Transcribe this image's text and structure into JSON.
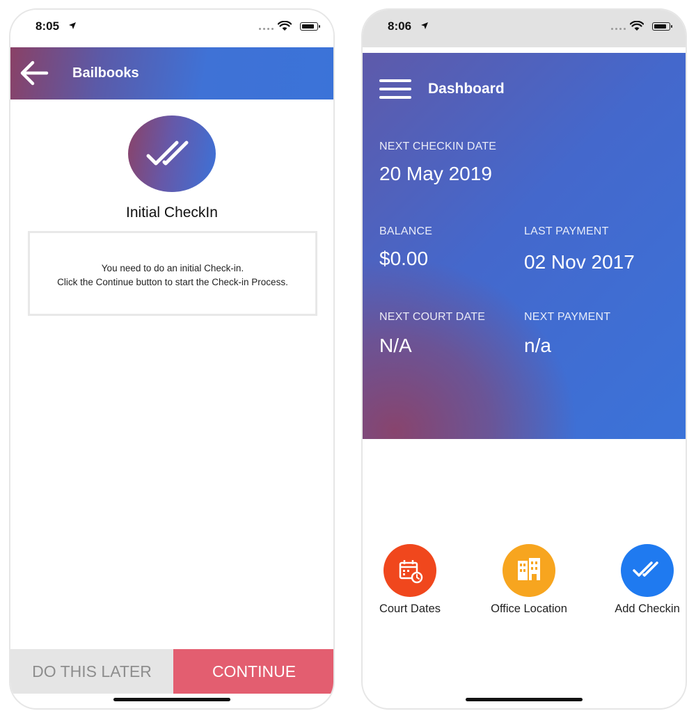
{
  "left": {
    "status": {
      "time": "8:05"
    },
    "appbar": {
      "title": "Bailbooks"
    },
    "heading": "Initial CheckIn",
    "message": {
      "line1": "You need to do an initial Check-in.",
      "line2": "Click the Continue button to start the Check-in Process."
    },
    "buttons": {
      "later": "DO THIS LATER",
      "continue": "CONTINUE"
    }
  },
  "right": {
    "status": {
      "time": "8:06"
    },
    "appbar": {
      "title": "Dashboard"
    },
    "next_checkin": {
      "label": "NEXT CHECKIN DATE",
      "value": "20 May 2019"
    },
    "balance": {
      "label": "BALANCE",
      "value": "$0.00"
    },
    "last_payment": {
      "label": "LAST PAYMENT",
      "value": "02 Nov 2017"
    },
    "next_court": {
      "label": "NEXT COURT DATE",
      "value": "N/A"
    },
    "next_payment": {
      "label": "NEXT PAYMENT",
      "value": "n/a"
    },
    "actions": [
      {
        "label": "Court Dates",
        "icon": "calendar-clock-icon",
        "color": "#f0471d"
      },
      {
        "label": "Office Location",
        "icon": "building-icon",
        "color": "#f7a51f"
      },
      {
        "label": "Add Checkin",
        "icon": "double-check-icon",
        "color": "#1f7af0"
      }
    ]
  },
  "colors": {
    "primary_blue": "#3b73d8",
    "gradient_purple": "#8a4166",
    "continue_red": "#e35e70",
    "later_gray": "#e5e5e5"
  }
}
